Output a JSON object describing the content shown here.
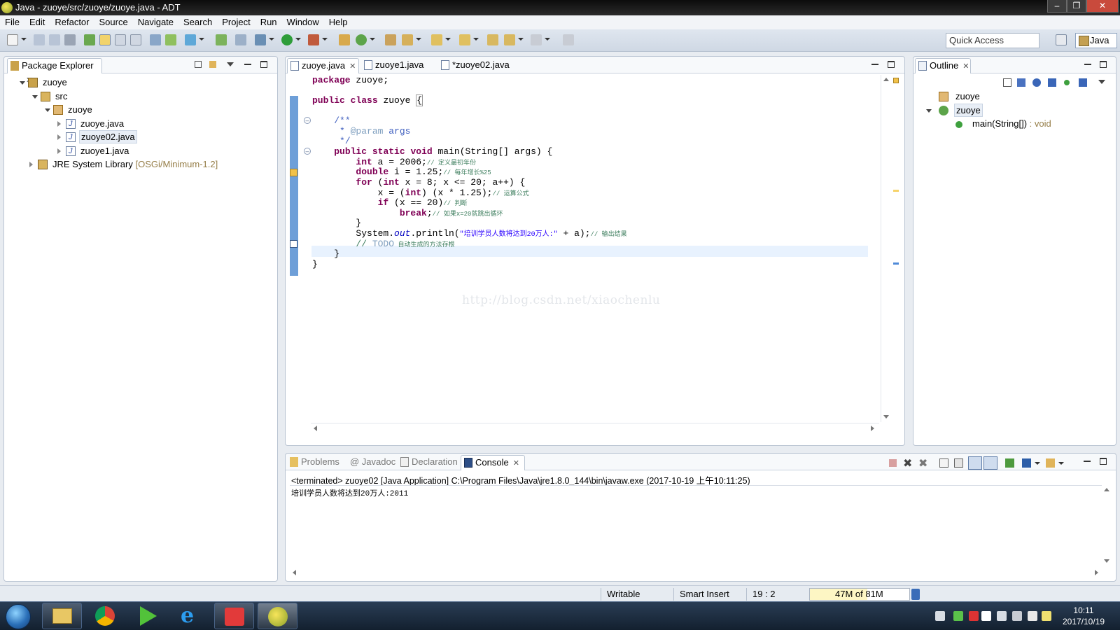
{
  "window": {
    "title": "Java - zuoye/src/zuoye/zuoye.java - ADT",
    "buttons": [
      "minimize",
      "maximize",
      "close"
    ]
  },
  "menu": [
    "File",
    "Edit",
    "Refactor",
    "Source",
    "Navigate",
    "Search",
    "Project",
    "Run",
    "Window",
    "Help"
  ],
  "toolbar": {
    "quick_access_placeholder": "Quick Access",
    "perspective": "Java"
  },
  "package_explorer": {
    "title": "Package Explorer",
    "tree": [
      {
        "label": "zuoye",
        "level": 0,
        "icon": "project-icon",
        "expanded": true
      },
      {
        "label": "src",
        "level": 1,
        "icon": "source-folder-icon",
        "expanded": true
      },
      {
        "label": "zuoye",
        "level": 2,
        "icon": "package-icon",
        "expanded": true
      },
      {
        "label": "zuoye.java",
        "level": 3,
        "icon": "java-file-icon",
        "expanded": false
      },
      {
        "label": "zuoye02.java",
        "level": 3,
        "icon": "java-file-icon",
        "expanded": false,
        "selected": true
      },
      {
        "label": "zuoye1.java",
        "level": 3,
        "icon": "java-file-icon",
        "expanded": false
      },
      {
        "label": "JRE System Library",
        "suffix": "[OSGi/Minimum-1.2]",
        "level": 1,
        "icon": "library-icon",
        "expanded": false
      }
    ]
  },
  "editor": {
    "tabs": [
      {
        "label": "zuoye.java",
        "active": true
      },
      {
        "label": "zuoye1.java",
        "active": false
      },
      {
        "label": "*zuoye02.java",
        "active": false
      }
    ],
    "code": {
      "l1": "package zuoye;",
      "l2": "public class zuoye {",
      "l3": "/**",
      "l4_tag": "@param",
      "l4_rest": "args",
      "l5": "*/",
      "l6": "main(String[] args) {",
      "l7": "a = 2006;",
      "l7c": "// 定义最初年份",
      "l8": "i = 1.25;",
      "l8c": "// 每年增长%25",
      "l9": "x = 8; x <= 20; a++) {",
      "l9c": "",
      "l10": "x = (",
      "l10b": ") (x * 1.25);",
      "l10c": "// 运算公式",
      "l11": "(x == 20)",
      "l11c": "// 判断",
      "l12c": "// 如果x=20就跳出循环",
      "l13": "}",
      "l14a": "System.",
      "l14b": "out",
      "l14c": ".println(",
      "l14s": "\"培训学员人数将达到20万人:\"",
      "l14d": " + a);",
      "l14e": "// 输出结果",
      "l15a": "// ",
      "l15b": "TODO",
      "l15c": " 自动生成的方法存根",
      "l16": "}",
      "l17": "}"
    },
    "watermark": "http://blog.csdn.net/xiaochenlu"
  },
  "outline": {
    "title": "Outline",
    "items": [
      {
        "label": "zuoye",
        "icon": "package-icon"
      },
      {
        "label": "zuoye",
        "icon": "class-icon",
        "selected": true
      },
      {
        "label": "main(String[])",
        "type": " : void",
        "icon": "method-icon"
      }
    ]
  },
  "bottom": {
    "tabs": [
      {
        "label": "Problems",
        "active": false
      },
      {
        "label": "@ Javadoc",
        "active": false
      },
      {
        "label": "Declaration",
        "active": false
      },
      {
        "label": "Console",
        "active": true
      }
    ],
    "console_header": "<terminated> zuoye02 [Java Application] C:\\Program Files\\Java\\jre1.8.0_144\\bin\\javaw.exe (2017-10-19 上午10:11:25)",
    "console_output": "培训学员人数将达到20万人:2011"
  },
  "status": {
    "writable": "Writable",
    "insert_mode": "Smart Insert",
    "position": "19 : 2",
    "heap": "47M of 81M"
  },
  "taskbar": {
    "time": "10:11",
    "date": "2017/10/19"
  }
}
